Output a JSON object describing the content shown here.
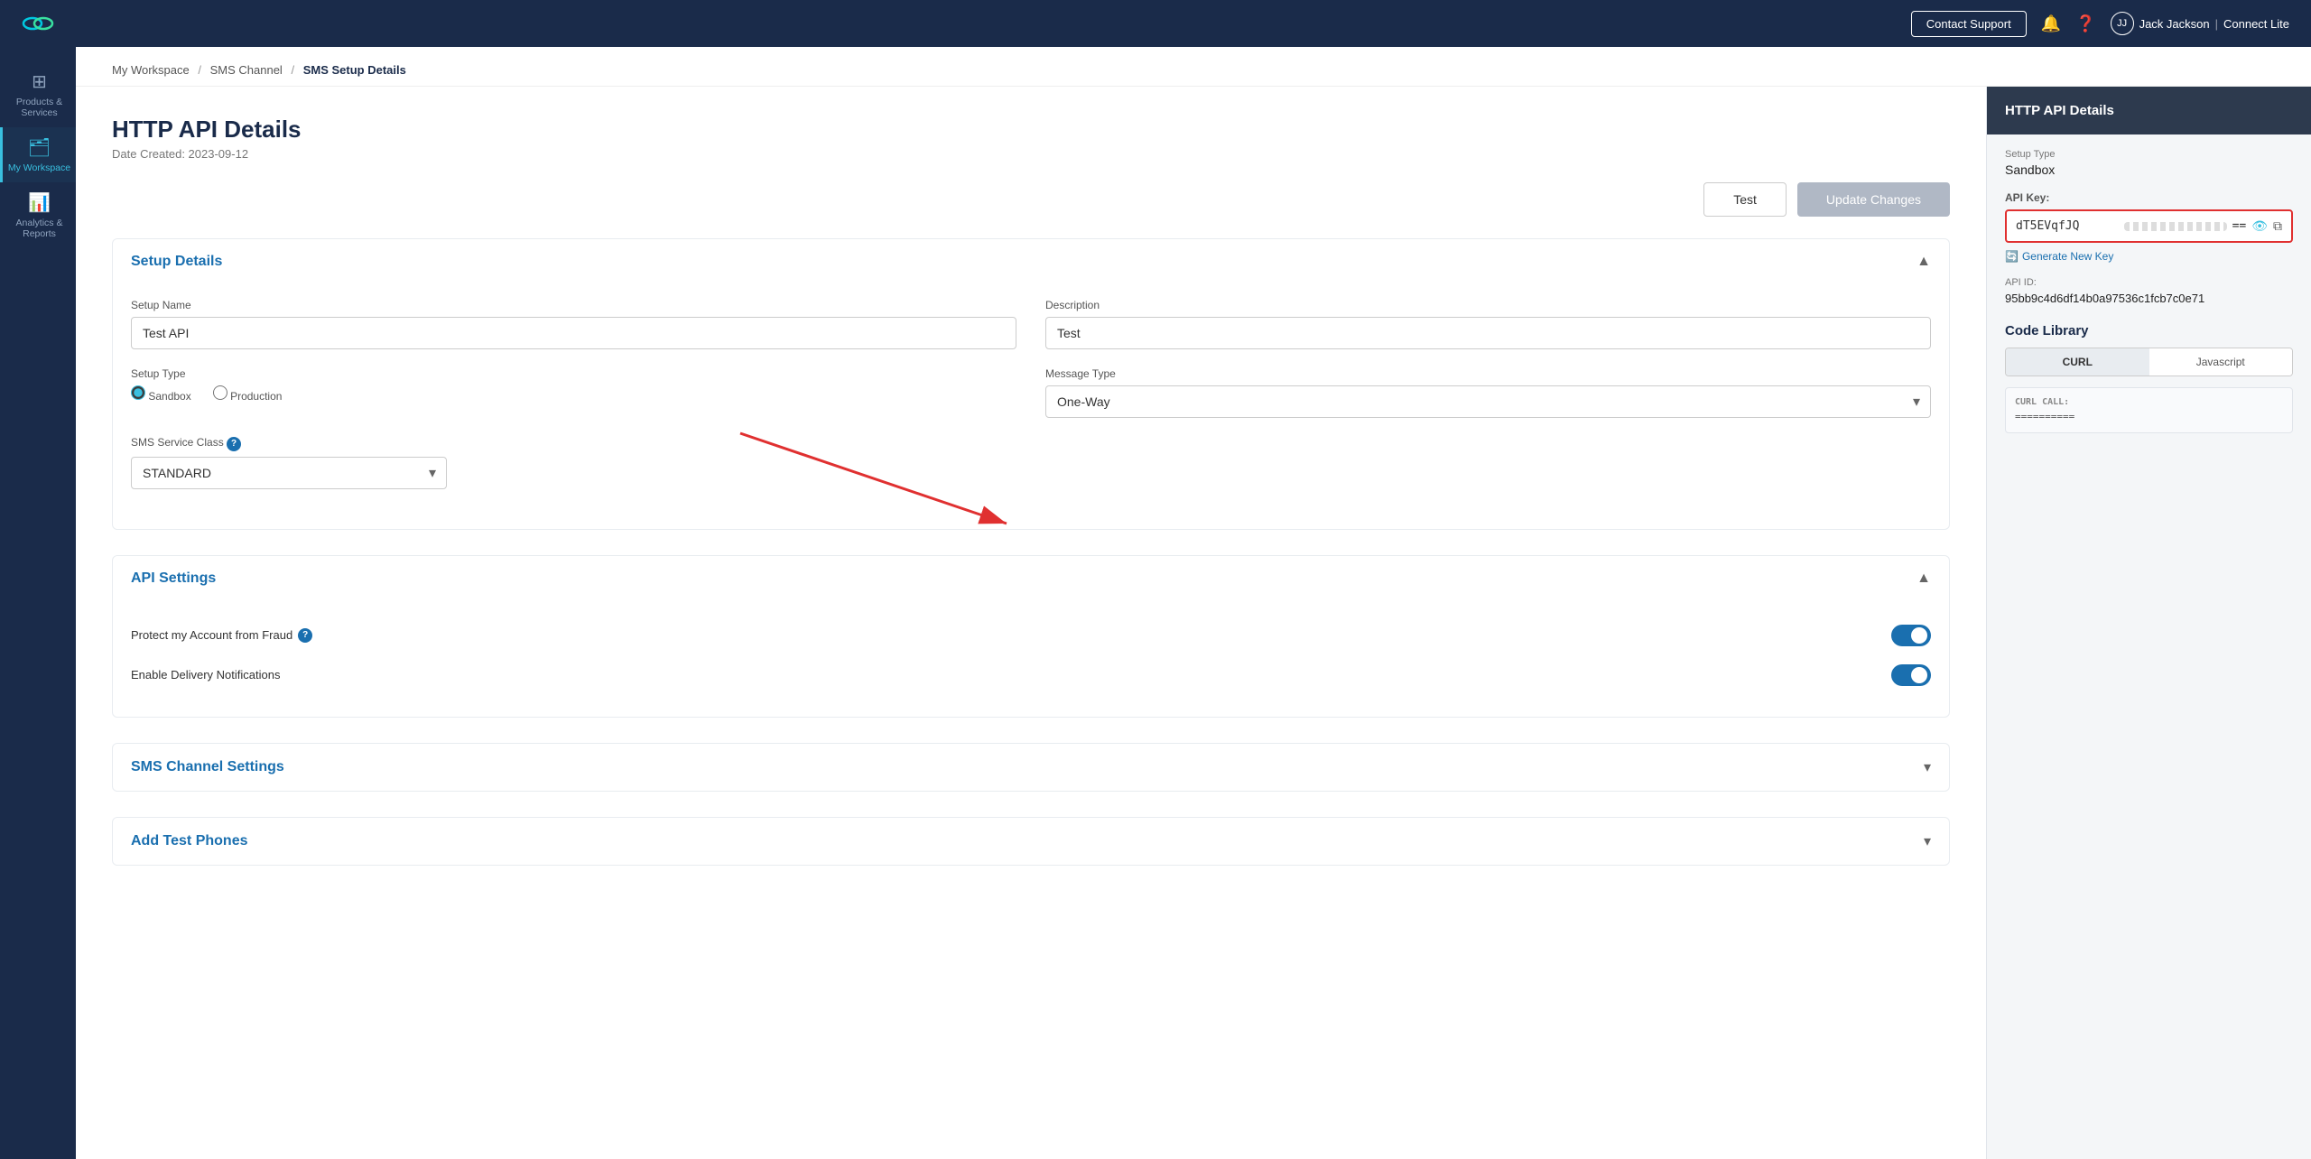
{
  "topNav": {
    "contactSupport": "Contact Support",
    "userName": "Jack Jackson",
    "planName": "Connect Lite"
  },
  "sidebar": {
    "items": [
      {
        "id": "products-services",
        "label": "Products & Services",
        "icon": "⊞",
        "active": false
      },
      {
        "id": "my-workspace",
        "label": "My Workspace",
        "icon": "📋",
        "active": true
      },
      {
        "id": "analytics-reports",
        "label": "Analytics & Reports",
        "icon": "📊",
        "active": false
      }
    ]
  },
  "breadcrumb": {
    "parts": [
      {
        "label": "My Workspace",
        "link": true
      },
      {
        "label": "SMS Channel",
        "link": true
      },
      {
        "label": "SMS Setup Details",
        "link": false
      }
    ]
  },
  "page": {
    "title": "HTTP API Details",
    "dateCreated": "Date Created: 2023-09-12"
  },
  "actions": {
    "testLabel": "Test",
    "updateLabel": "Update Changes"
  },
  "setupDetails": {
    "sectionTitle": "Setup Details",
    "setupNameLabel": "Setup Name",
    "setupNameValue": "Test API",
    "descriptionLabel": "Description",
    "descriptionValue": "Test",
    "setupTypeLabel": "Setup Type",
    "setupTypeSandbox": "Sandbox",
    "setupTypeProduction": "Production",
    "messageTypeLabel": "Message Type",
    "messageTypeValue": "One-Way",
    "smsServiceClassLabel": "SMS Service Class",
    "smsServiceClassValue": "STANDARD"
  },
  "apiSettings": {
    "sectionTitle": "API Settings",
    "fraudLabel": "Protect my Account from Fraud",
    "deliveryLabel": "Enable Delivery Notifications"
  },
  "smsChannelSettings": {
    "sectionTitle": "SMS Channel Settings"
  },
  "addTestPhones": {
    "sectionTitle": "Add Test Phones"
  },
  "rightPanel": {
    "title": "HTTP API Details",
    "setupTypeLabel": "Setup Type",
    "setupTypeValue": "Sandbox",
    "apiKeyLabel": "API Key:",
    "apiKeyPrefix": "dT5EVqfJQ",
    "apiKeyEquals": "==",
    "generateNewKey": "Generate New Key",
    "apiIdLabel": "API ID:",
    "apiIdValue": "95bb9c4d6df14b0a97536c1fcb7c0e71",
    "codeLibraryTitle": "Code Library",
    "curlTab": "CURL",
    "javascriptTab": "Javascript",
    "curlCallLabel": "CURL CALL:",
    "curlLines": "=========="
  }
}
